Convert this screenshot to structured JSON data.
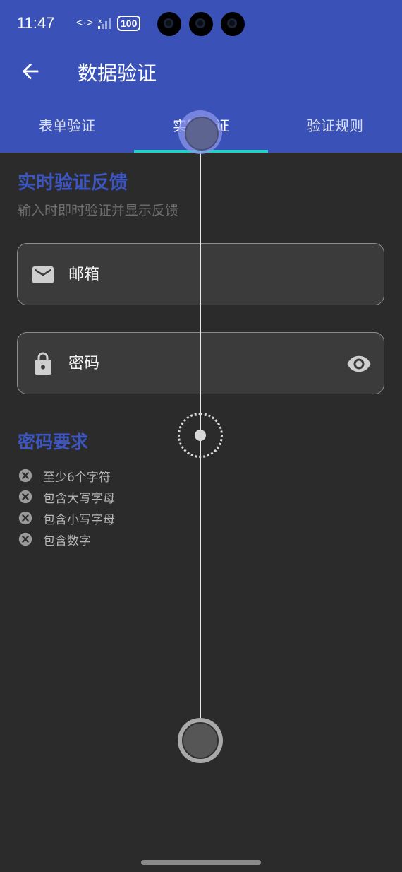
{
  "status_bar": {
    "time": "11:47",
    "data_icon": "<·>",
    "battery": "100"
  },
  "app_bar": {
    "title": "数据验证",
    "back_icon": "arrow-left-icon"
  },
  "tabs": [
    {
      "label": "表单验证",
      "selected": false
    },
    {
      "label": "实时验证",
      "selected": true
    },
    {
      "label": "验证规则",
      "selected": false
    }
  ],
  "section": {
    "title": "实时验证反馈",
    "subtitle": "输入时即时验证并显示反馈"
  },
  "fields": {
    "email": {
      "placeholder": "邮箱",
      "value": "",
      "icon": "mail-icon"
    },
    "password": {
      "placeholder": "密码",
      "value": "",
      "icon": "lock-icon",
      "toggle_icon": "eye-icon"
    }
  },
  "requirements": {
    "title": "密码要求",
    "items": [
      {
        "label": "至少6个字符",
        "met": false
      },
      {
        "label": "包含大写字母",
        "met": false
      },
      {
        "label": "包含小写字母",
        "met": false
      },
      {
        "label": "包含数字",
        "met": false
      }
    ]
  },
  "colors": {
    "primary": "#3a52b8",
    "accent_indicator": "#21d1c4",
    "section_title": "#3d55c0",
    "background": "#2b2b2b"
  }
}
